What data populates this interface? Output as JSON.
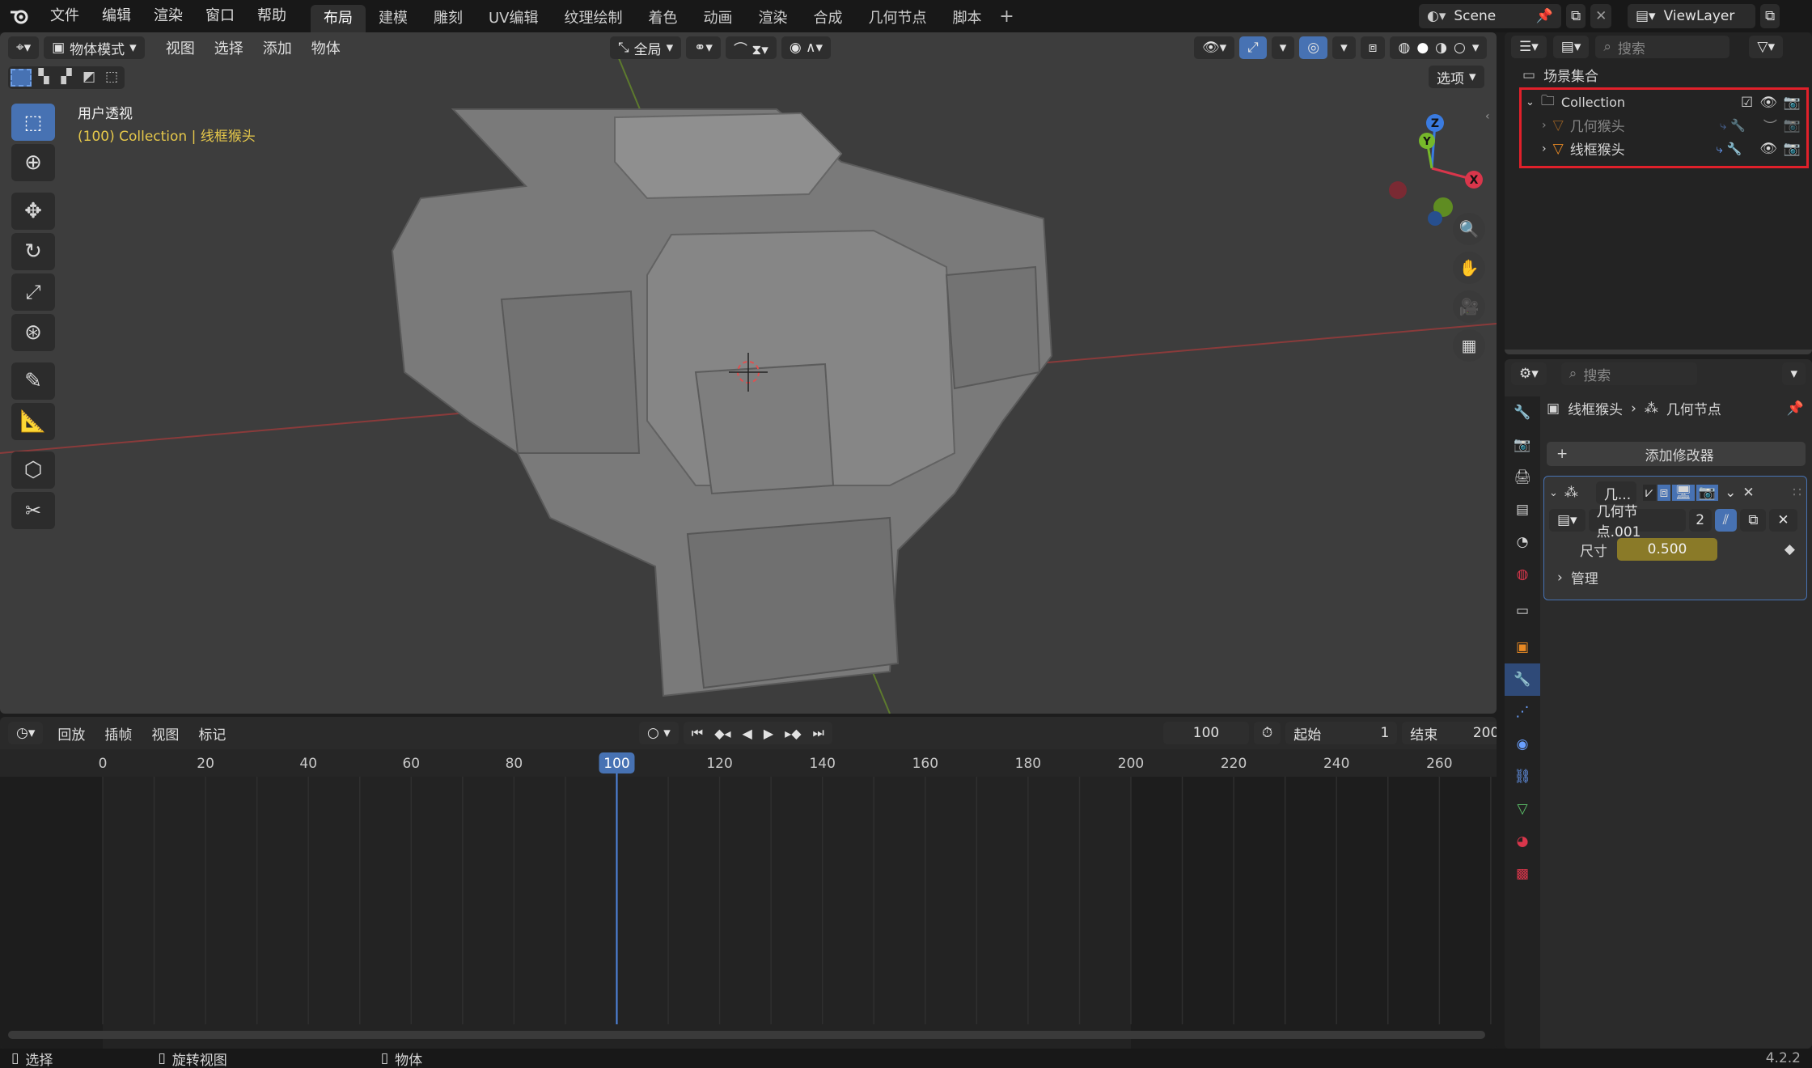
{
  "topbar": {
    "menus": [
      "文件",
      "编辑",
      "渲染",
      "窗口",
      "帮助"
    ],
    "workspaces": [
      "布局",
      "建模",
      "雕刻",
      "UV编辑",
      "纹理绘制",
      "着色",
      "动画",
      "渲染",
      "合成",
      "几何节点",
      "脚本"
    ],
    "active_workspace": "布局",
    "scene": "Scene",
    "view_layer": "ViewLayer"
  },
  "viewport": {
    "mode": "物体模式",
    "menus": [
      "视图",
      "选择",
      "添加",
      "物体"
    ],
    "transform_orientation": "全局",
    "options_label": "选项",
    "view_name": "用户透视",
    "view_subtitle": "(100) Collection | 线框猴头",
    "gizmo": {
      "x": "X",
      "y": "Y",
      "z": "Z"
    },
    "tools": [
      "select-box-icon",
      "cursor-icon",
      "move-icon",
      "rotate-icon",
      "scale-icon",
      "transform-icon",
      "annotate-icon",
      "measure-icon",
      "add-cube-icon",
      "scissors-icon"
    ]
  },
  "timeline": {
    "menus": [
      "回放",
      "插帧",
      "视图",
      "标记"
    ],
    "current_frame": "100",
    "start_label": "起始",
    "start_value": "1",
    "end_label": "结束",
    "end_value": "200",
    "ruler": [
      "0",
      "20",
      "40",
      "60",
      "80",
      "100",
      "120",
      "140",
      "160",
      "180",
      "200",
      "220",
      "240",
      "260"
    ],
    "playhead_frame": 100,
    "frame_range_end": 200
  },
  "outliner": {
    "search_placeholder": "搜索",
    "root": "场景集合",
    "collection": "Collection",
    "items": [
      {
        "name": "几何猴头",
        "visible": false
      },
      {
        "name": "线框猴头",
        "visible": true
      }
    ]
  },
  "properties": {
    "search_placeholder": "搜索",
    "breadcrumb_object": "线框猴头",
    "breadcrumb_modifier": "几何节点",
    "add_modifier": "添加修改器",
    "modifier_name": "几...",
    "node_group": "几何节点.001",
    "users": "2",
    "size_label": "尺寸",
    "size_value": "0.500",
    "manage_label": "管理"
  },
  "statusbar": {
    "select": "选择",
    "rotate_view": "旋转视图",
    "object": "物体",
    "version": "4.2.2"
  },
  "colors": {
    "accent": "#4772b3",
    "highlight_box": "#e0202a",
    "value_field": "#8a7a28",
    "subtitle": "#e6c84a"
  }
}
